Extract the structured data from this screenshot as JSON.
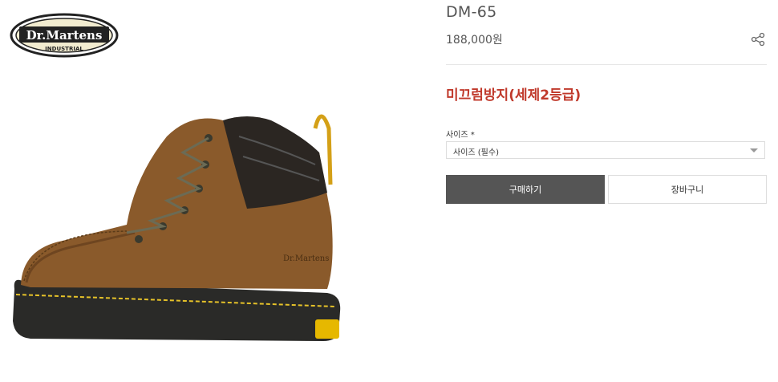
{
  "brand": {
    "logo_text_main": "Dr.Martens",
    "logo_text_sub": "INDUSTRIAL"
  },
  "product": {
    "name": "DM-65",
    "price": "188,000원",
    "promo": "미끄럼방지(세제2등급)"
  },
  "options": {
    "size_label": "사이즈 *",
    "size_selected": "사이즈 (필수)"
  },
  "actions": {
    "buy_label": "구매하기",
    "cart_label": "장바구니"
  },
  "colors": {
    "promo": "#c0392b",
    "buy_button": "#555555"
  },
  "icons": {
    "share": "share-icon"
  }
}
